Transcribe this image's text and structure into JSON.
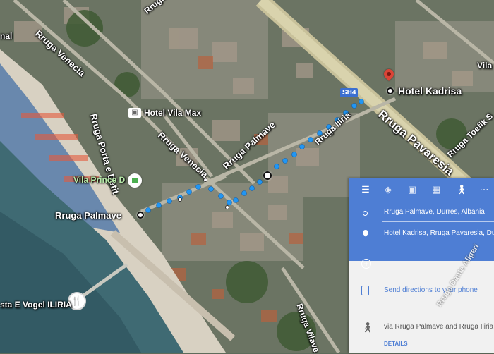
{
  "map": {
    "roads": {
      "rruga_venecia_north": "Rruga Venecia",
      "rruga_porta_e_detit": "Rruga Porta e Detit",
      "rruga_venecia": "Rruga Venecia",
      "rruga_palmave": "Rruga Palmave",
      "rruga_iliria": "Rruga Iliria",
      "rruga_pavaresia": "Rruga Pavaresia",
      "rruga_toefik": "Rruga Toefik S",
      "rruga_vilave": "Rruga Vilave",
      "rruga_dante": "Rruga Dante Aligeri",
      "rruga_edge": "Rruga"
    },
    "places": {
      "hotel_kadrisa": "Hotel Kadrisa",
      "hotel_vila_max": "Hotel Vila Max",
      "vila_prince": "Vila Prince D",
      "rruga_palmave_origin": "Rruga Palmave",
      "restaurant": "sta E Vogel ILIRIA",
      "edge_top_left": "nal",
      "edge_top_right": "Vila"
    },
    "route_shield": "SH4",
    "colors": {
      "route_dots": "#2196f3",
      "pin": "#db4437",
      "panel_header": "#4e7ed4"
    }
  },
  "panel": {
    "modes": [
      "menu-icon",
      "drive-best-icon",
      "car-icon",
      "transit-icon",
      "walk-icon",
      "more-icon"
    ],
    "origin": "Rruga Palmave, Durrës, Albania",
    "destination": "Hotel Kadrisa, Rruga Pavaresia, Durrës",
    "send_directions": "Send directions to your phone",
    "route_summary": "via Rruga Palmave and Rruga Iliria",
    "details": "DETAILS"
  }
}
